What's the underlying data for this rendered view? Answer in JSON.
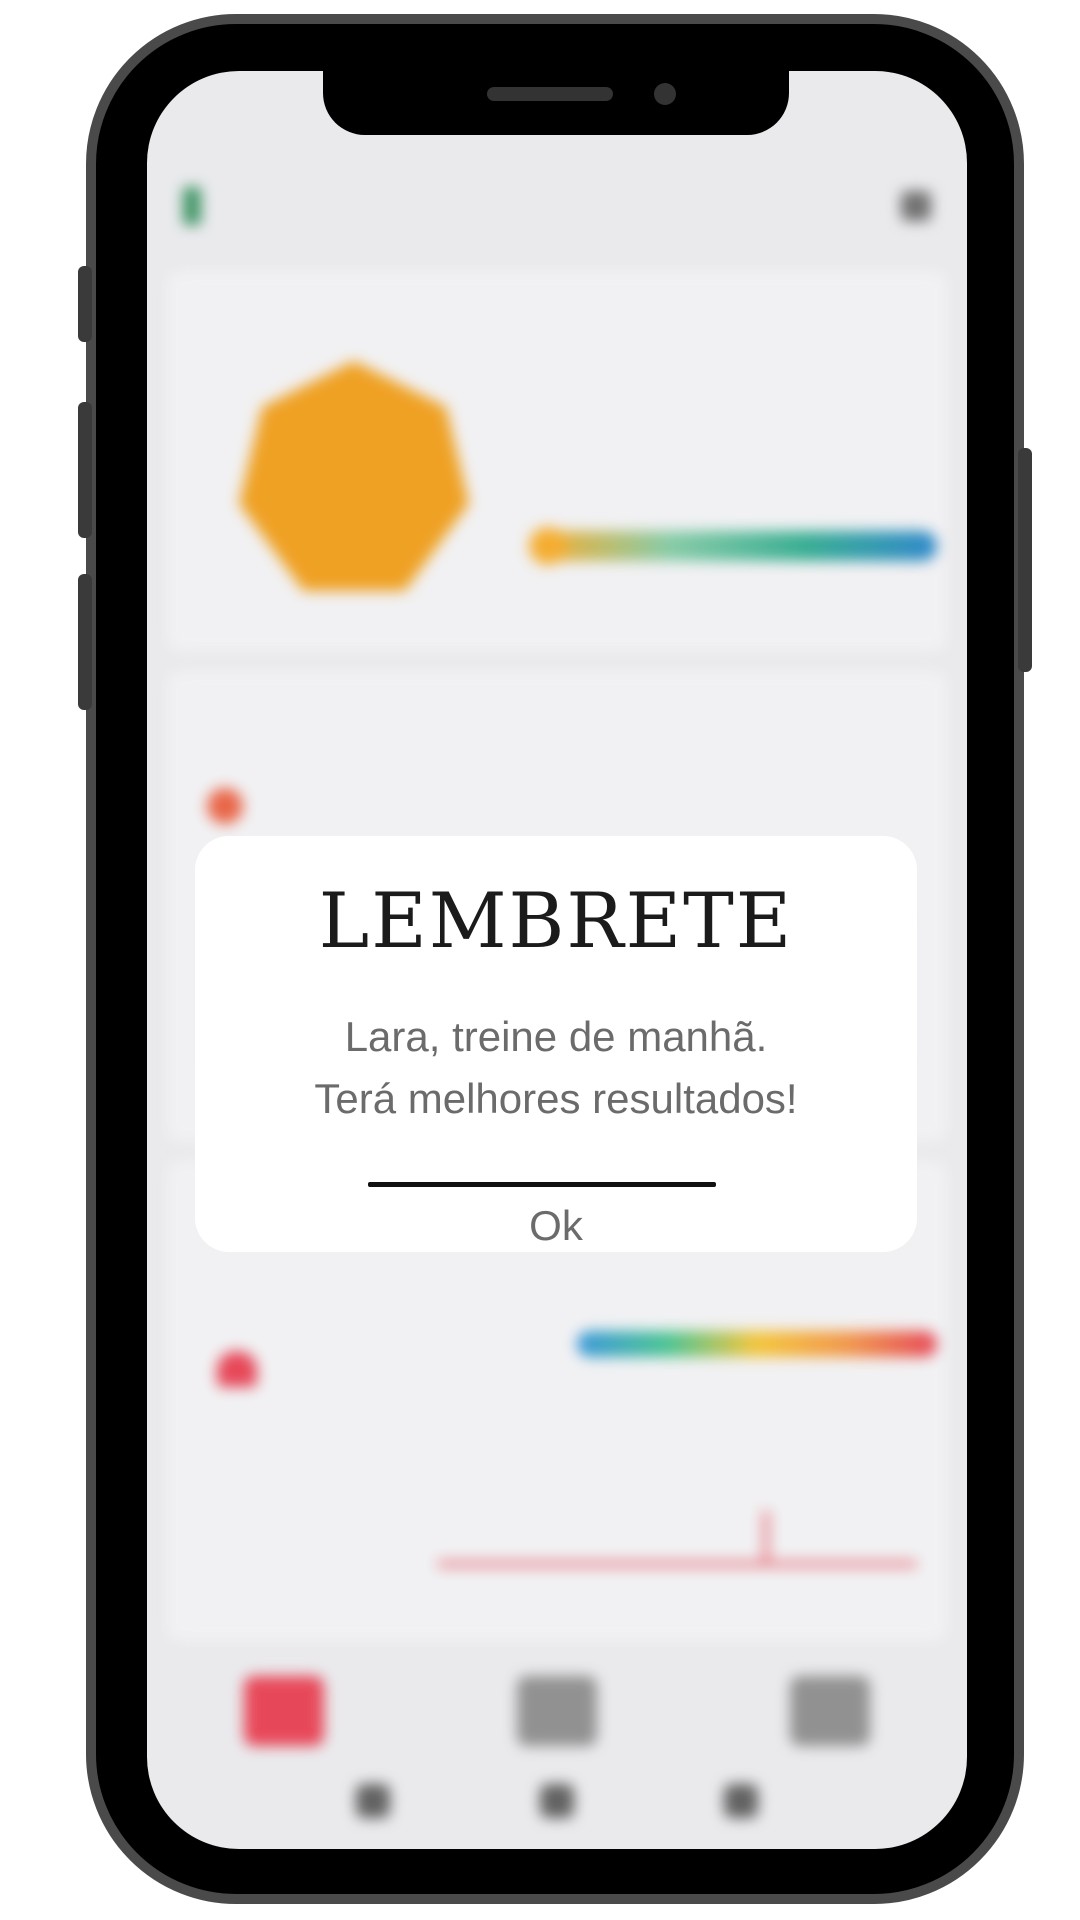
{
  "dialog": {
    "title": "LEMBRETE",
    "message_line1": "Lara, treine de manhã.",
    "message_line2": "Terá melhores resultados!",
    "ok_label": "Ok"
  },
  "colors": {
    "pai_orange": "#ee9a12",
    "heart_red": "#e5394b",
    "dialog_bg": "#ffffff",
    "title_text": "#1b1b1b",
    "body_text": "#6b6b6b"
  },
  "icons": [
    "battery-icon",
    "grid-icon",
    "heart-icon",
    "tab-icon",
    "nav-back-icon",
    "nav-home-icon",
    "nav-recent-icon"
  ]
}
